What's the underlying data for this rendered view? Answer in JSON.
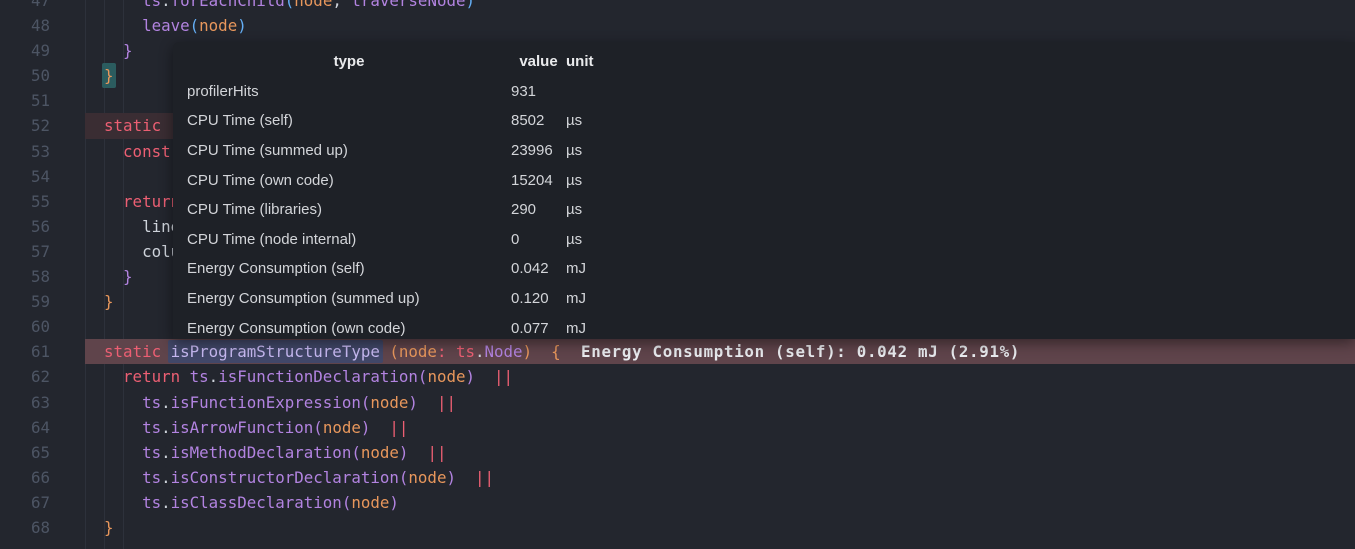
{
  "editor": {
    "colors": {
      "background": "#23262e",
      "tooltip_background": "#1e2127",
      "gutter_foreground": "#4d5564",
      "line_highlight_hot": "#5f444b",
      "line_highlight_warm": "#3a2d33",
      "word_highlight_background": "#414768",
      "bracket_match_background": "#2b5c5f",
      "indent_guide": "#2d313b"
    },
    "palette": {
      "plain": "#ced3db",
      "keyword": "#ec5f73",
      "func": "#b283e0",
      "type": "#b283e0",
      "param": "#e8975c",
      "brace": "#e8975c",
      "paren-blue": "#64aef5",
      "ident-hl": "#c7b9f2",
      "match": "#e8975c",
      "annotation": "#e9ebef"
    },
    "lines": [
      {
        "num": "47",
        "tokens": [
          {
            "t": "      ",
            "s": "plain"
          },
          {
            "t": "ts",
            "s": "func"
          },
          {
            "t": ".",
            "s": "plain"
          },
          {
            "t": "forEachChild",
            "s": "func"
          },
          {
            "t": "(",
            "s": "paren-blue"
          },
          {
            "t": "node",
            "s": "param"
          },
          {
            "t": ",",
            "s": "plain"
          },
          {
            "t": " ",
            "s": "plain"
          },
          {
            "t": "traverseNode",
            "s": "func"
          },
          {
            "t": ")",
            "s": "paren-blue"
          }
        ]
      },
      {
        "num": "48",
        "tokens": [
          {
            "t": "      ",
            "s": "plain"
          },
          {
            "t": "leave",
            "s": "func"
          },
          {
            "t": "(",
            "s": "paren-blue"
          },
          {
            "t": "node",
            "s": "param"
          },
          {
            "t": ")",
            "s": "paren-blue"
          }
        ]
      },
      {
        "num": "49",
        "tokens": [
          {
            "t": "    ",
            "s": "plain"
          },
          {
            "t": "}",
            "s": "func"
          }
        ]
      },
      {
        "num": "50",
        "tokens": [
          {
            "t": "  ",
            "s": "plain"
          },
          {
            "t": "}",
            "s": "match"
          }
        ]
      },
      {
        "num": "51",
        "tokens": []
      },
      {
        "num": "52",
        "hl": "line_highlight_warm",
        "tokens": [
          {
            "t": "  ",
            "s": "plain"
          },
          {
            "t": "static",
            "s": "keyword"
          }
        ]
      },
      {
        "num": "53",
        "tokens": [
          {
            "t": "    ",
            "s": "plain"
          },
          {
            "t": "const",
            "s": "keyword"
          }
        ]
      },
      {
        "num": "54",
        "tokens": []
      },
      {
        "num": "55",
        "tokens": [
          {
            "t": "    ",
            "s": "plain"
          },
          {
            "t": "return",
            "s": "keyword"
          }
        ]
      },
      {
        "num": "56",
        "tokens": [
          {
            "t": "      ",
            "s": "plain"
          },
          {
            "t": "line",
            "s": "plain"
          }
        ]
      },
      {
        "num": "57",
        "tokens": [
          {
            "t": "      ",
            "s": "plain"
          },
          {
            "t": "column",
            "s": "plain"
          }
        ]
      },
      {
        "num": "58",
        "tokens": [
          {
            "t": "    ",
            "s": "plain"
          },
          {
            "t": "}",
            "s": "func"
          }
        ]
      },
      {
        "num": "59",
        "tokens": [
          {
            "t": "  ",
            "s": "plain"
          },
          {
            "t": "}",
            "s": "brace"
          }
        ]
      },
      {
        "num": "60",
        "tokens": []
      },
      {
        "num": "61",
        "hl": "line_highlight_hot",
        "tokens": [
          {
            "t": "  ",
            "s": "plain"
          },
          {
            "t": "static",
            "s": "keyword"
          },
          {
            "t": " ",
            "s": "plain"
          },
          {
            "t": "isProgramStructureType",
            "s": "ident-hl"
          },
          {
            "t": " ",
            "s": "plain"
          },
          {
            "t": "(",
            "s": "brace"
          },
          {
            "t": "node",
            "s": "param"
          },
          {
            "t": ":",
            "s": "keyword"
          },
          {
            "t": " ",
            "s": "plain"
          },
          {
            "t": "ts",
            "s": "keyword"
          },
          {
            "t": ".",
            "s": "plain"
          },
          {
            "t": "Node",
            "s": "type"
          },
          {
            "t": ")",
            "s": "brace"
          },
          {
            "t": "  ",
            "s": "plain"
          },
          {
            "t": "{",
            "s": "brace"
          },
          {
            "t": "  Energy Consumption (self): 0.042 mJ (2.91%)",
            "s": "annotation"
          }
        ]
      },
      {
        "num": "62",
        "tokens": [
          {
            "t": "    ",
            "s": "plain"
          },
          {
            "t": "return",
            "s": "keyword"
          },
          {
            "t": " ",
            "s": "plain"
          },
          {
            "t": "ts",
            "s": "func"
          },
          {
            "t": ".",
            "s": "plain"
          },
          {
            "t": "isFunctionDeclaration",
            "s": "func"
          },
          {
            "t": "(",
            "s": "func"
          },
          {
            "t": "node",
            "s": "param"
          },
          {
            "t": ")",
            "s": "func"
          },
          {
            "t": "  ",
            "s": "plain"
          },
          {
            "t": "||",
            "s": "keyword"
          }
        ]
      },
      {
        "num": "63",
        "tokens": [
          {
            "t": "      ",
            "s": "plain"
          },
          {
            "t": "ts",
            "s": "func"
          },
          {
            "t": ".",
            "s": "plain"
          },
          {
            "t": "isFunctionExpression",
            "s": "func"
          },
          {
            "t": "(",
            "s": "func"
          },
          {
            "t": "node",
            "s": "param"
          },
          {
            "t": ")",
            "s": "func"
          },
          {
            "t": "  ",
            "s": "plain"
          },
          {
            "t": "||",
            "s": "keyword"
          }
        ]
      },
      {
        "num": "64",
        "tokens": [
          {
            "t": "      ",
            "s": "plain"
          },
          {
            "t": "ts",
            "s": "func"
          },
          {
            "t": ".",
            "s": "plain"
          },
          {
            "t": "isArrowFunction",
            "s": "func"
          },
          {
            "t": "(",
            "s": "func"
          },
          {
            "t": "node",
            "s": "param"
          },
          {
            "t": ")",
            "s": "func"
          },
          {
            "t": "  ",
            "s": "plain"
          },
          {
            "t": "||",
            "s": "keyword"
          }
        ]
      },
      {
        "num": "65",
        "tokens": [
          {
            "t": "      ",
            "s": "plain"
          },
          {
            "t": "ts",
            "s": "func"
          },
          {
            "t": ".",
            "s": "plain"
          },
          {
            "t": "isMethodDeclaration",
            "s": "func"
          },
          {
            "t": "(",
            "s": "func"
          },
          {
            "t": "node",
            "s": "param"
          },
          {
            "t": ")",
            "s": "func"
          },
          {
            "t": "  ",
            "s": "plain"
          },
          {
            "t": "||",
            "s": "keyword"
          }
        ]
      },
      {
        "num": "66",
        "tokens": [
          {
            "t": "      ",
            "s": "plain"
          },
          {
            "t": "ts",
            "s": "func"
          },
          {
            "t": ".",
            "s": "plain"
          },
          {
            "t": "isConstructorDeclaration",
            "s": "func"
          },
          {
            "t": "(",
            "s": "func"
          },
          {
            "t": "node",
            "s": "param"
          },
          {
            "t": ")",
            "s": "func"
          },
          {
            "t": "  ",
            "s": "plain"
          },
          {
            "t": "||",
            "s": "keyword"
          }
        ]
      },
      {
        "num": "67",
        "tokens": [
          {
            "t": "      ",
            "s": "plain"
          },
          {
            "t": "ts",
            "s": "func"
          },
          {
            "t": ".",
            "s": "plain"
          },
          {
            "t": "isClassDeclaration",
            "s": "func"
          },
          {
            "t": "(",
            "s": "func"
          },
          {
            "t": "node",
            "s": "param"
          },
          {
            "t": ")",
            "s": "func"
          }
        ]
      },
      {
        "num": "68",
        "tokens": [
          {
            "t": "  ",
            "s": "plain"
          },
          {
            "t": "}",
            "s": "brace"
          }
        ]
      }
    ]
  },
  "tooltip": {
    "headers": {
      "type": "type",
      "value": "value",
      "unit": "unit"
    },
    "rows": [
      {
        "type": "profilerHits",
        "value": "931",
        "unit": ""
      },
      {
        "type": "CPU Time (self)",
        "value": "8502",
        "unit": "µs"
      },
      {
        "type": "CPU Time (summed up)",
        "value": "23996",
        "unit": "µs"
      },
      {
        "type": "CPU Time (own code)",
        "value": "15204",
        "unit": "µs"
      },
      {
        "type": "CPU Time (libraries)",
        "value": "290",
        "unit": "µs"
      },
      {
        "type": "CPU Time (node internal)",
        "value": "0",
        "unit": "µs"
      },
      {
        "type": "Energy Consumption (self)",
        "value": "0.042",
        "unit": "mJ"
      },
      {
        "type": "Energy Consumption (summed up)",
        "value": "0.120",
        "unit": "mJ"
      },
      {
        "type": "Energy Consumption (own code)",
        "value": "0.077",
        "unit": "mJ"
      }
    ]
  }
}
